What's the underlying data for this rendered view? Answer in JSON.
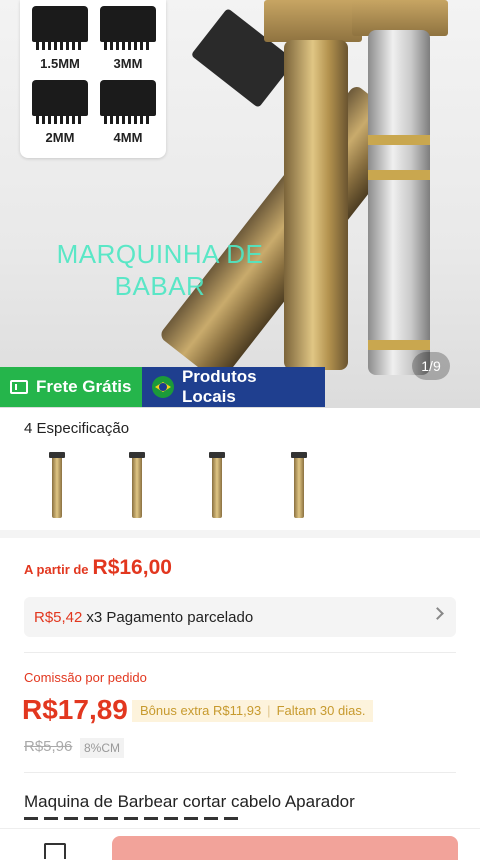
{
  "hero": {
    "guides": [
      "1.5MM",
      "3MM",
      "2MM",
      "4MM"
    ],
    "watermark_line1": "MARQUINHA DE",
    "watermark_line2": "BABAR",
    "counter": "1/9"
  },
  "badges": {
    "free_shipping": "Frete Grátis",
    "local_products": "Produtos Locais"
  },
  "specs": {
    "title": "4 Especificação",
    "count": 4
  },
  "price": {
    "from_label": "A partir de",
    "from_value": "R$16,00",
    "install_amount": "R$5,42",
    "install_text": "x3 Pagamento parcelado",
    "commission_label": "Comissão por pedido",
    "commission_value": "R$17,89",
    "bonus_text": "Bônus extra R$11,93",
    "days_left": "Faltam 30 dias.",
    "old_price": "R$5,96",
    "cm_rate": "8%CM"
  },
  "product": {
    "title": "Maquina de Barbear cortar cabelo Aparador"
  },
  "colors": {
    "accent_red": "#e2371f",
    "free_green": "#25b54b",
    "local_blue": "#1f3f8f",
    "buy_button": "#f2a39a"
  }
}
